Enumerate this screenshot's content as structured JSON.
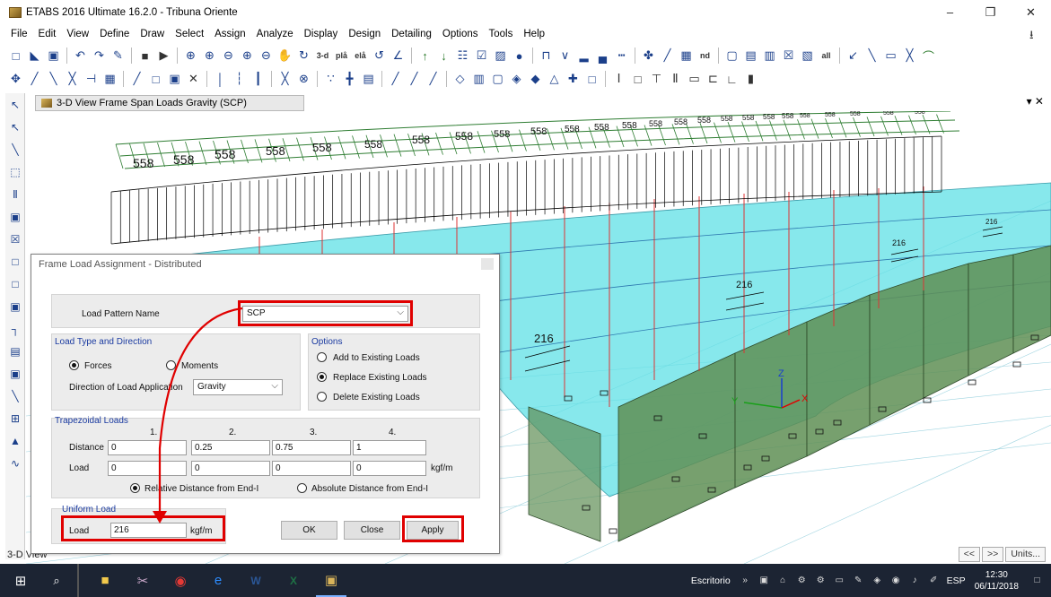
{
  "window": {
    "title": "ETABS 2016 Ultimate 16.2.0 - Tribuna Oriente",
    "minimize": "–",
    "maximize": "❐",
    "close": "✕"
  },
  "menu": [
    "File",
    "Edit",
    "View",
    "Define",
    "Draw",
    "Select",
    "Assign",
    "Analyze",
    "Display",
    "Design",
    "Detailing",
    "Options",
    "Tools",
    "Help"
  ],
  "toolbar": {
    "text_items": {
      "view3d": "3-d",
      "plan": "plå",
      "elev": "elå",
      "nd": "nd",
      "all": "all"
    }
  },
  "view": {
    "tab_label": "3-D View  Frame Span Loads Gravity (SCP)",
    "status_label": "3-D View",
    "nav": [
      "<<",
      ">>",
      "Units..."
    ],
    "load_labels_main": "558",
    "load_labels_small": "216",
    "axis": {
      "x": "X",
      "y": "Y",
      "z": "Z"
    }
  },
  "dialog": {
    "title": "Frame Load Assignment - Distributed",
    "load_pattern_label": "Load Pattern Name",
    "load_pattern_value": "SCP",
    "load_type_group": "Load Type and Direction",
    "forces_label": "Forces",
    "moments_label": "Moments",
    "direction_label": "Direction of Load Application",
    "direction_value": "Gravity",
    "options_group": "Options",
    "option_add": "Add to Existing Loads",
    "option_replace": "Replace Existing Loads",
    "option_delete": "Delete Existing Loads",
    "trapezoidal_group": "Trapezoidal Loads",
    "col_headers": [
      "1.",
      "2.",
      "3.",
      "4."
    ],
    "distance_label": "Distance",
    "distance_values": [
      "0",
      "0.25",
      "0.75",
      "1"
    ],
    "load_label": "Load",
    "load_values": [
      "0",
      "0",
      "0",
      "0"
    ],
    "load_unit": "kgf/m",
    "relative_label": "Relative Distance from End-I",
    "absolute_label": "Absolute Distance from End-I",
    "uniform_group": "Uniform Load",
    "uniform_load_label": "Load",
    "uniform_load_value": "216",
    "uniform_unit": "kgf/m",
    "ok": "OK",
    "close": "Close",
    "apply": "Apply"
  },
  "taskbar": {
    "desktop_label": "Escritorio",
    "lang": "ESP",
    "time": "12:30",
    "date": "06/11/2018"
  },
  "colors": {
    "highlight": "#e00000",
    "slab": "#5fe0e6",
    "wall": "#5f8f55",
    "truss": "#2e7d32"
  }
}
